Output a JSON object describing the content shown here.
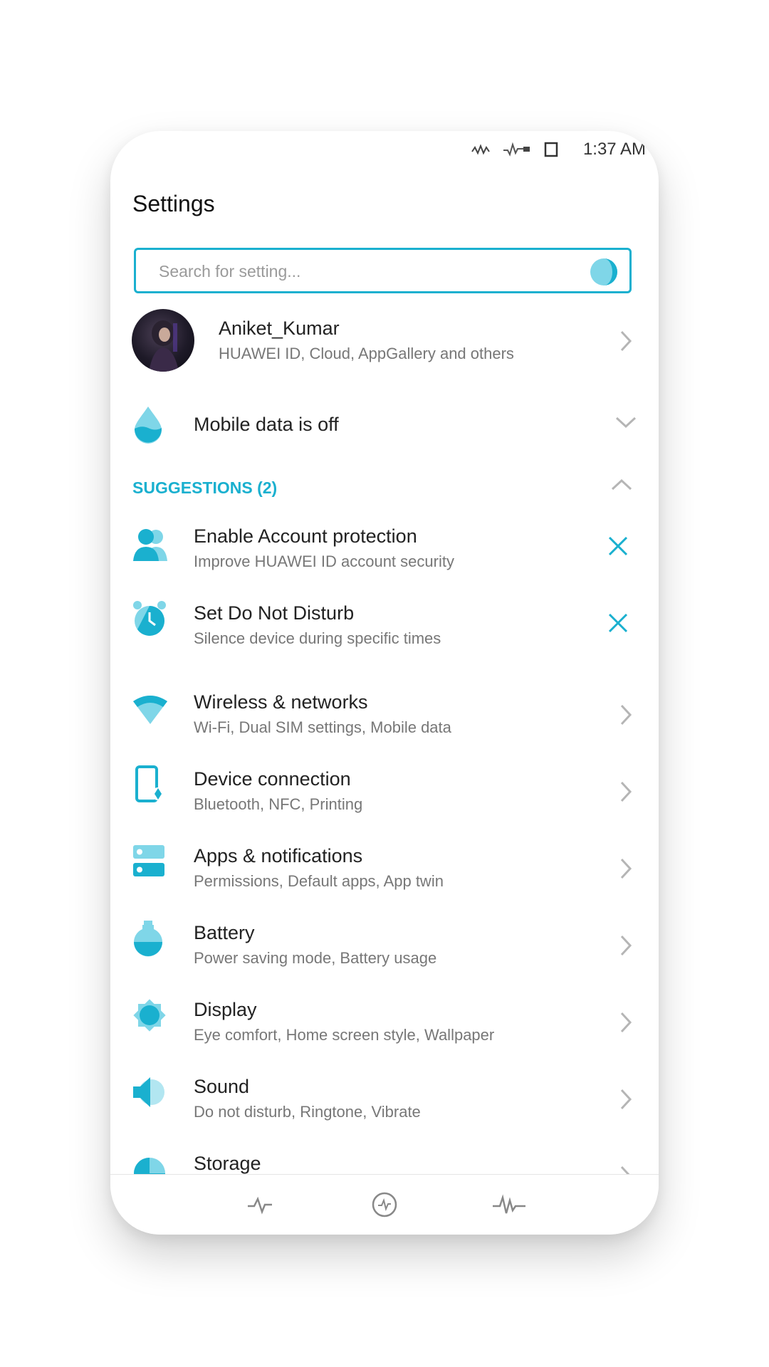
{
  "status_bar": {
    "time": "1:37 AM",
    "icons": [
      "vibrate-icon",
      "signal-wave-icon",
      "screen-icon"
    ]
  },
  "page": {
    "title": "Settings"
  },
  "search": {
    "placeholder": "Search for setting..."
  },
  "account": {
    "name": "Aniket_Kumar",
    "subtitle": "HUAWEI ID, Cloud, AppGallery and others"
  },
  "mobile_data": {
    "label": "Mobile data is off"
  },
  "suggestions": {
    "header": "SUGGESTIONS (2)",
    "items": [
      {
        "title": "Enable Account protection",
        "subtitle": "Improve HUAWEI ID account security",
        "icon": "account-protection-icon"
      },
      {
        "title": "Set Do Not Disturb",
        "subtitle": "Silence device during specific times",
        "icon": "alarm-clock-icon"
      }
    ]
  },
  "settings": {
    "items": [
      {
        "title": "Wireless & networks",
        "subtitle": "Wi-Fi, Dual SIM settings, Mobile data",
        "icon": "wifi-icon"
      },
      {
        "title": "Device connection",
        "subtitle": "Bluetooth, NFC, Printing",
        "icon": "device-connection-icon"
      },
      {
        "title": "Apps & notifications",
        "subtitle": "Permissions, Default apps, App twin",
        "icon": "apps-icon"
      },
      {
        "title": "Battery",
        "subtitle": "Power saving mode, Battery usage",
        "icon": "battery-icon"
      },
      {
        "title": "Display",
        "subtitle": "Eye comfort, Home screen style, Wallpaper",
        "icon": "display-icon"
      },
      {
        "title": "Sound",
        "subtitle": "Do not disturb, Ringtone, Vibrate",
        "icon": "sound-icon"
      },
      {
        "title": "Storage",
        "subtitle": "",
        "icon": "storage-icon"
      }
    ]
  },
  "colors": {
    "accent": "#1ab0cf",
    "icon_light": "#7fd6e8"
  }
}
